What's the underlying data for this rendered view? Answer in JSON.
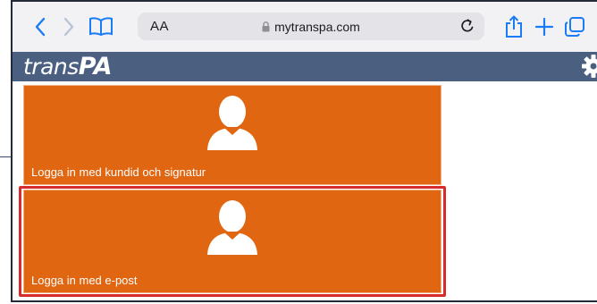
{
  "browser": {
    "reader_label": "AA",
    "url": "mytranspa.com"
  },
  "app": {
    "logo_part1": "trans",
    "logo_part2": "PA"
  },
  "tiles": [
    {
      "label": "Logga in med kundid och signatur"
    },
    {
      "label": "Logga in med e-post"
    }
  ],
  "colors": {
    "tile_orange": "#e06611",
    "header_blue": "#4b5f80",
    "highlight_red": "#d72b2b",
    "toolbar_blue": "#1a7cf5"
  }
}
